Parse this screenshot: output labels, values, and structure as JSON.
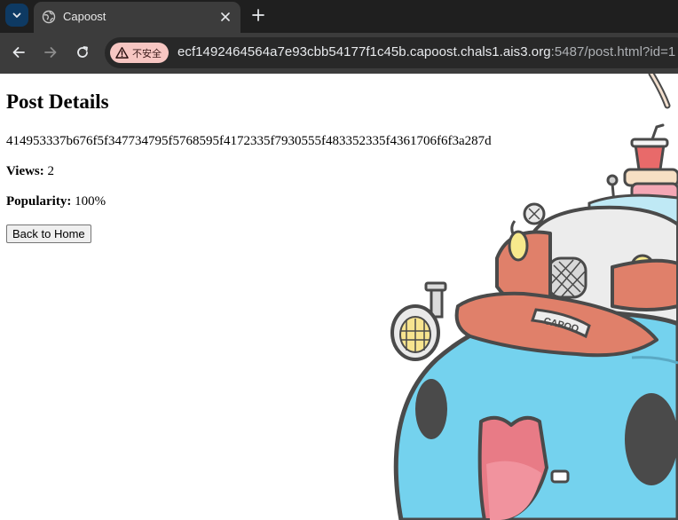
{
  "browser": {
    "tab": {
      "title": "Capoost"
    },
    "address_bar": {
      "security_label": "不安全",
      "url_host": "ecf1492464564a7e93cbb54177f1c45b.capoost.chals1.ais3.org",
      "url_rest": ":5487/post.html?id=1"
    },
    "icons": {
      "tab_search": "chevron-down-icon",
      "favicon": "globe-icon",
      "tab_close": "close-icon",
      "new_tab": "plus-icon",
      "back": "arrow-left-icon",
      "forward": "arrow-right-icon",
      "reload": "reload-icon",
      "security": "warning-triangle-icon"
    },
    "colors": {
      "tabstrip": "#1f1f1f",
      "toolbar": "#3c3c3c",
      "omnibox": "#282828",
      "security_chip": "#f7c6c2"
    }
  },
  "page": {
    "heading": "Post Details",
    "post_id": "414953337b676f5f347734795f5768595f4172335f7930555f483352335f4361706f6f3a287d",
    "views_label": "Views:",
    "views_value": "2",
    "popularity_label": "Popularity:",
    "popularity_value": "100%",
    "back_button": "Back to Home",
    "background": {
      "description_icon": "capoo-mascot-illustration",
      "hat_text": "CAPOO",
      "colors": {
        "body": "#74d2ee",
        "hat": "#e0806a",
        "outline": "#4a4a4a",
        "tongue": "#e87b86"
      }
    }
  }
}
